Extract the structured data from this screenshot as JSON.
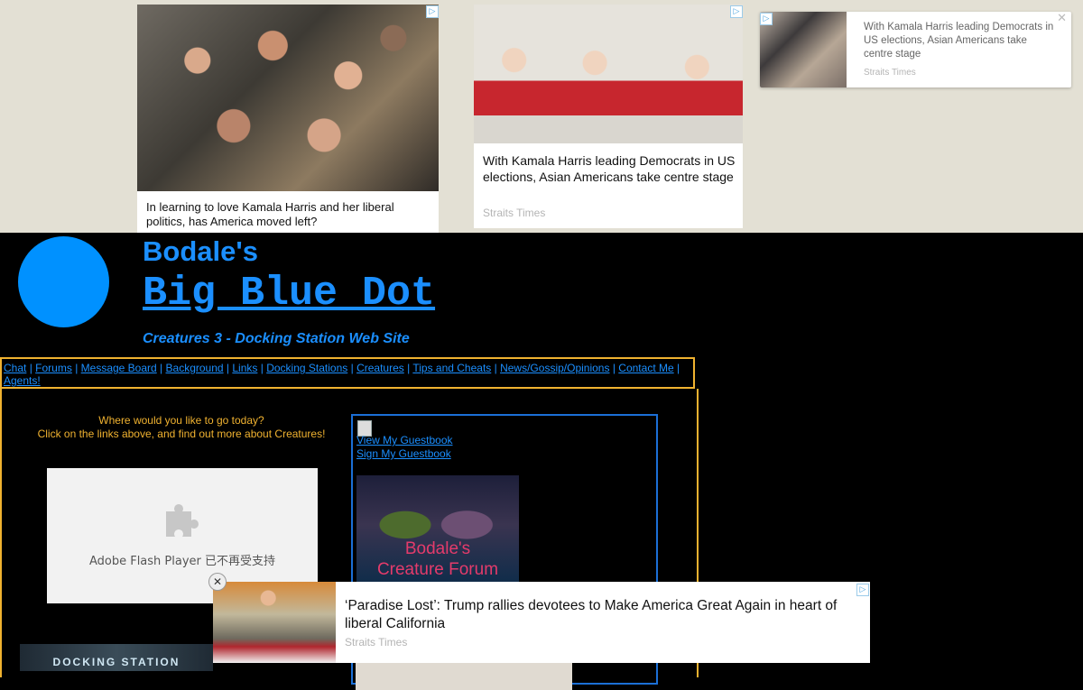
{
  "ads": {
    "ad1": {
      "headline": "In learning to love Kamala Harris and her liberal politics, has America moved left?",
      "badge": "▷"
    },
    "ad2": {
      "headline": "With Kamala Harris leading Democrats in US elections, Asian Americans take centre stage",
      "source": "Straits Times",
      "badge": "▷"
    },
    "ad3": {
      "headline": "With Kamala Harris leading Democrats in US elections, Asian Americans take centre stage",
      "source": "Straits Times",
      "close": "✕",
      "badge": "▷"
    },
    "bottom": {
      "headline": "‘Paradise Lost’: Trump rallies devotees to Make America Great Again in heart of liberal California",
      "source": "Straits Times",
      "close": "✕",
      "badge": "▷"
    }
  },
  "header": {
    "title_line1": "Bodale's",
    "title_line2": "Big Blue Dot",
    "subtitle": "Creatures 3 - Docking Station Web Site"
  },
  "nav": {
    "items": [
      "Chat",
      "Forums",
      "Message Board",
      "Background",
      "Links",
      "Docking Stations",
      "Creatures",
      "Tips and Cheats",
      "News/Gossip/Opinions",
      "Contact Me",
      "Agents!"
    ],
    "separator": "|"
  },
  "main": {
    "welcome_line1": "Where would you like to go today?",
    "welcome_line2": "Click on the links above, and find out more about Creatures!",
    "flash_label": "Adobe Flash Player 已不再受支持",
    "docking_banner": "DOCKING STATION"
  },
  "guestbook": {
    "view": "View My Guestbook",
    "sign": "Sign My Guestbook",
    "forum_line1": "Bodale's",
    "forum_line2": "Creature Forum"
  },
  "colors": {
    "accent_blue": "#1b8fff",
    "dot_blue": "#0091ff",
    "border_orange": "#f0b230"
  }
}
